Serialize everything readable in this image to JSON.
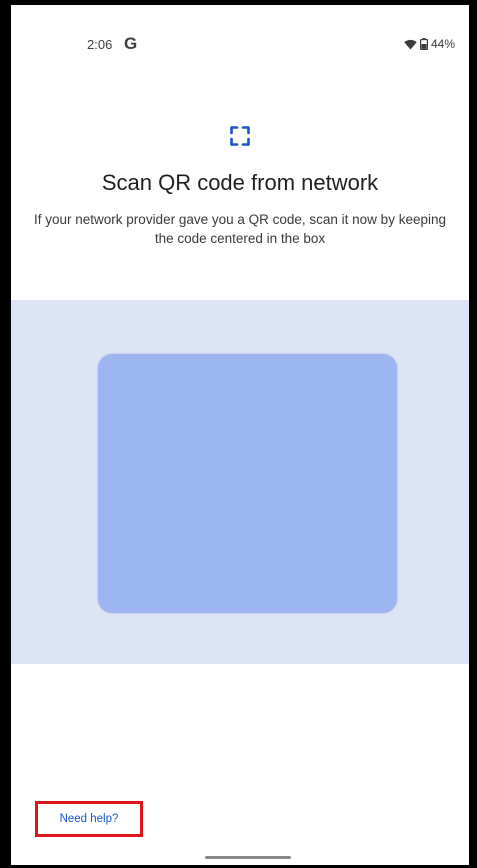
{
  "status_bar": {
    "time": "2:06",
    "google_letter": "G",
    "battery_percent": "44%",
    "icons": [
      "wifi-icon",
      "battery-icon"
    ]
  },
  "header": {
    "icon": "qr-scan-icon",
    "title": "Scan QR code from network",
    "subtitle": "If your network provider gave you a QR code, scan it now by keeping the code centered in the box"
  },
  "camera": {
    "background_color": "#dde4f6",
    "scan_box_color": "#9db5f0"
  },
  "footer": {
    "help_label": "Need help?",
    "highlight_color": "#e0141c",
    "link_color": "#1a56c8"
  }
}
